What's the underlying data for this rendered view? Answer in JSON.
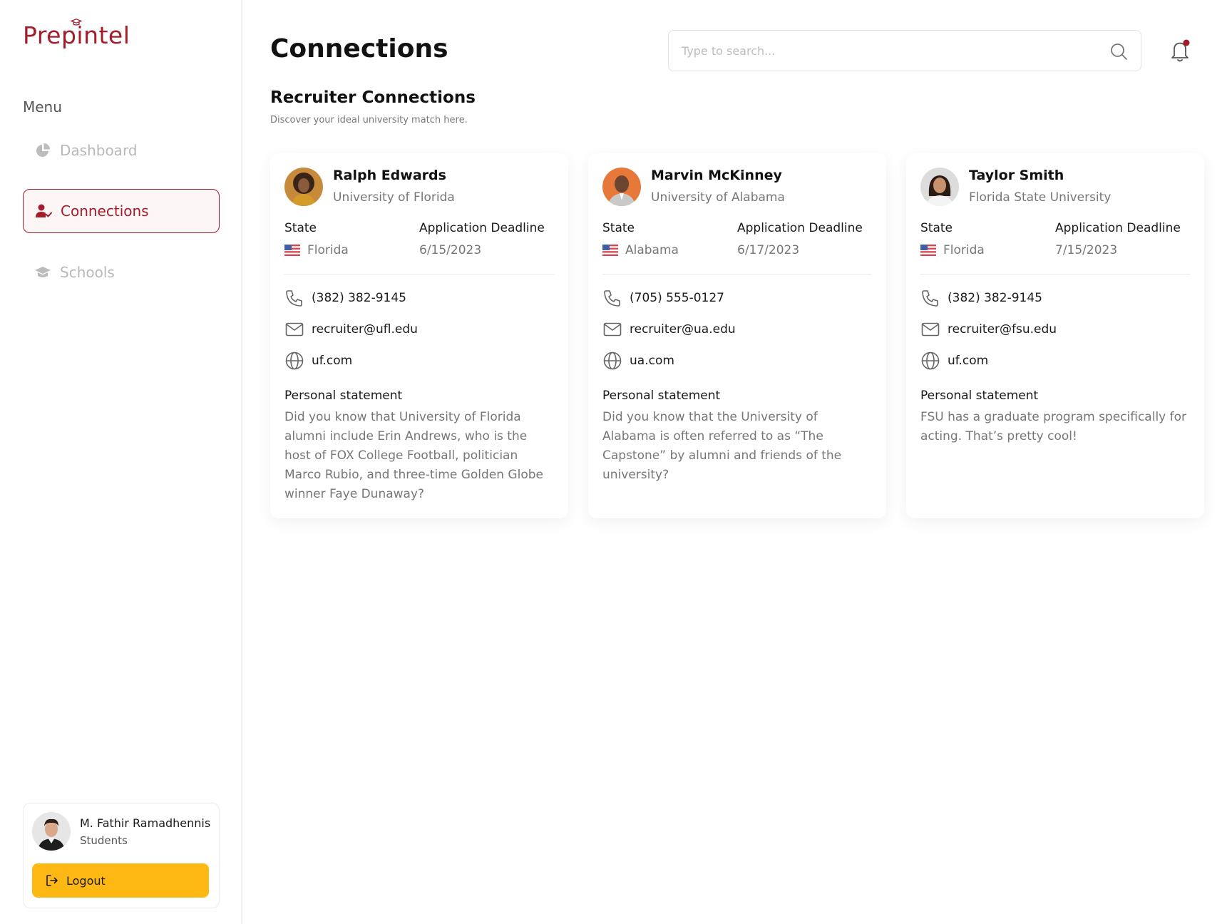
{
  "app": {
    "logo_text": "Prepintel"
  },
  "sidebar": {
    "menu_title": "Menu",
    "items": [
      {
        "label": "Dashboard",
        "icon": "pie-chart-icon",
        "active": false
      },
      {
        "label": "Connections",
        "icon": "user-check-icon",
        "active": true
      },
      {
        "label": "Schools",
        "icon": "graduation-cap-icon",
        "active": false
      }
    ],
    "user": {
      "name": "M. Fathir Ramadhennis",
      "role": "Students"
    },
    "logout_label": "Logout"
  },
  "header": {
    "title": "Connections",
    "search_placeholder": "Type to search..."
  },
  "section": {
    "title": "Recruiter Connections",
    "subtitle": "Discover your ideal university match here."
  },
  "labels": {
    "state": "State",
    "deadline": "Application Deadline",
    "statement": "Personal statement"
  },
  "cards": [
    {
      "name": "Ralph Edwards",
      "university": "University of Florida",
      "state": "Florida",
      "deadline": "6/15/2023",
      "phone": "(382) 382-9145",
      "email": "recruiter@ufl.edu",
      "website": "uf.com",
      "statement": "Did you know that University of Florida alumni include Erin Andrews, who is the host of FOX College Football, politician Marco Rubio, and three-time Golden Globe winner Faye Dunaway?"
    },
    {
      "name": "Marvin McKinney",
      "university": "University of Alabama",
      "state": "Alabama",
      "deadline": "6/17/2023",
      "phone": "(705) 555-0127",
      "email": "recruiter@ua.edu",
      "website": "ua.com",
      "statement": "Did you know that the University of Alabama is often referred to as “The Capstone” by alumni and friends of the university?"
    },
    {
      "name": "Taylor Smith",
      "university": "Florida State University",
      "state": "Florida",
      "deadline": "7/15/2023",
      "phone": "(382) 382-9145",
      "email": "recruiter@fsu.edu",
      "website": "uf.com",
      "statement": "FSU has a graduate program specifically for acting. That’s pretty cool!"
    }
  ],
  "colors": {
    "brand": "#a51d2a",
    "accent": "#fdb813",
    "muted": "#777777"
  }
}
